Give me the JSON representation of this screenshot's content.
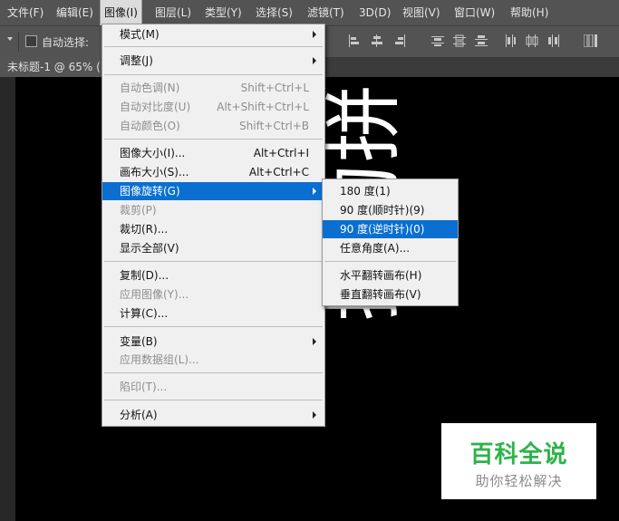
{
  "menubar": [
    {
      "label": "文件(F)"
    },
    {
      "label": "编辑(E)"
    },
    {
      "label": "图像(I)"
    },
    {
      "label": "图层(L)"
    },
    {
      "label": "类型(Y)"
    },
    {
      "label": "选择(S)"
    },
    {
      "label": "滤镜(T)"
    },
    {
      "label": "3D(D)"
    },
    {
      "label": "视图(V)"
    },
    {
      "label": "窗口(W)"
    },
    {
      "label": "帮助(H)"
    }
  ],
  "options": {
    "auto_select_label": "自动选择:"
  },
  "document_tab": "未标题-1 @ 65% (",
  "canvas_text": "搜狗拼",
  "image_menu": {
    "items": [
      {
        "label": "模式(M)"
      },
      {
        "label": "调整(J)"
      },
      {
        "label": "自动色调(N)",
        "shortcut": "Shift+Ctrl+L"
      },
      {
        "label": "自动对比度(U)",
        "shortcut": "Alt+Shift+Ctrl+L"
      },
      {
        "label": "自动颜色(O)",
        "shortcut": "Shift+Ctrl+B"
      },
      {
        "label": "图像大小(I)...",
        "shortcut": "Alt+Ctrl+I"
      },
      {
        "label": "画布大小(S)...",
        "shortcut": "Alt+Ctrl+C"
      },
      {
        "label": "图像旋转(G)"
      },
      {
        "label": "裁剪(P)"
      },
      {
        "label": "裁切(R)..."
      },
      {
        "label": "显示全部(V)"
      },
      {
        "label": "复制(D)..."
      },
      {
        "label": "应用图像(Y)..."
      },
      {
        "label": "计算(C)..."
      },
      {
        "label": "变量(B)"
      },
      {
        "label": "应用数据组(L)..."
      },
      {
        "label": "陷印(T)..."
      },
      {
        "label": "分析(A)"
      }
    ]
  },
  "rotate_menu": {
    "items": [
      {
        "label": "180 度(1)"
      },
      {
        "label": "90 度(顺时针)(9)"
      },
      {
        "label": "90 度(逆时针)(0)"
      },
      {
        "label": "任意角度(A)..."
      },
      {
        "label": "水平翻转画布(H)"
      },
      {
        "label": "垂直翻转画布(V)"
      }
    ]
  },
  "watermark": {
    "title": "百科全说",
    "subtitle": "助你轻松解决"
  }
}
